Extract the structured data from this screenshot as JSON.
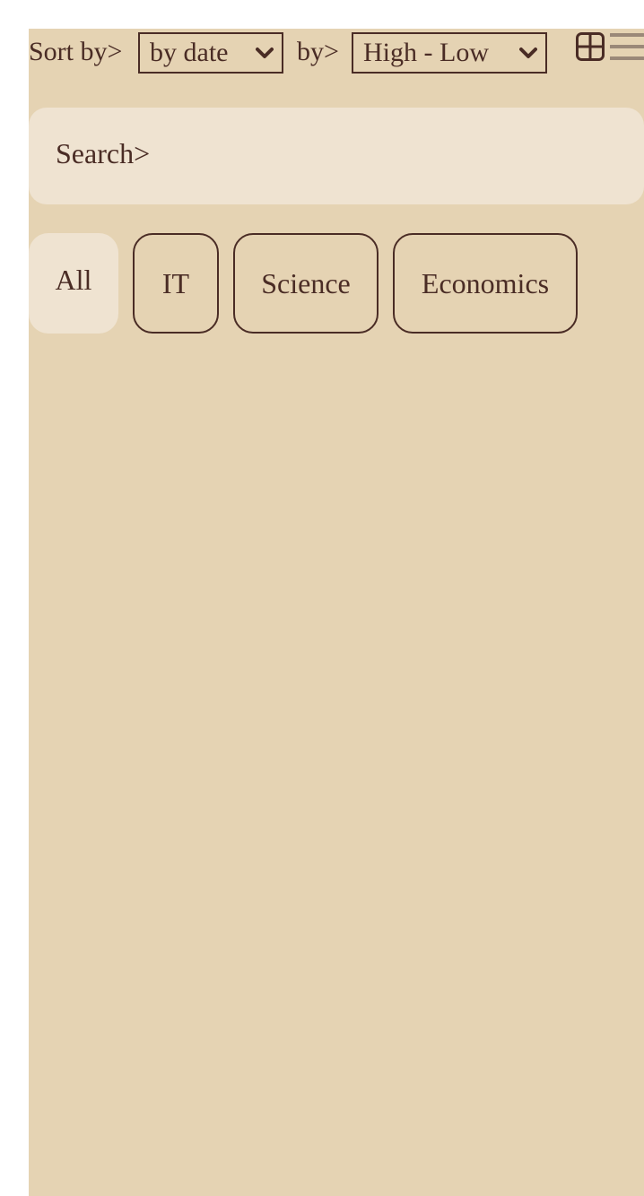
{
  "toolbar": {
    "sort_label": "Sort by>",
    "sort_value": "by date",
    "order_label": "by>",
    "order_value": "High - Low",
    "grid_icon": "grid-view-icon",
    "list_icon": "list-view-icon"
  },
  "search": {
    "placeholder": "Search>"
  },
  "categories": [
    {
      "label": "All",
      "active": true
    },
    {
      "label": "IT",
      "active": false
    },
    {
      "label": "Science",
      "active": false
    },
    {
      "label": "Economics",
      "active": false
    }
  ],
  "colors": {
    "page_background": "#ffffff",
    "panel_background": "#e5d3b3",
    "input_background": "#efe3d1",
    "text": "#4a2c25",
    "inactive_icon": "#9a8878"
  }
}
